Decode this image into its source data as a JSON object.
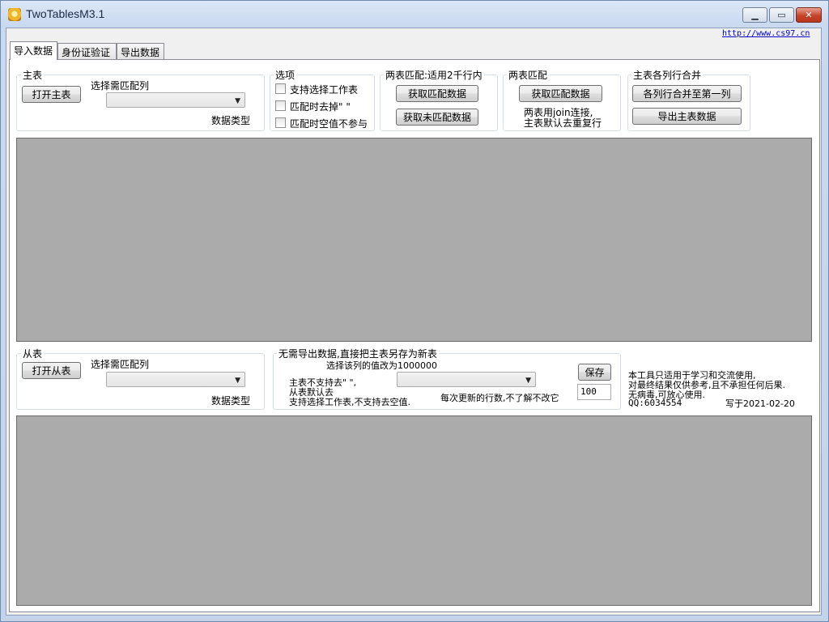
{
  "window": {
    "title": "TwoTablesM3.1",
    "minimize_glyph": "▁",
    "maximize_glyph": "▭",
    "close_glyph": "✕"
  },
  "header": {
    "link": "http://www.cs97.cn"
  },
  "tabs": [
    {
      "label": "导入数据",
      "active": true
    },
    {
      "label": "身份证验证",
      "active": false
    },
    {
      "label": "导出数据",
      "active": false
    }
  ],
  "main_table": {
    "group_label": "主表",
    "open_button": "打开主表",
    "select_label": "选择需匹配列",
    "select_value": "",
    "data_type_label": "数据类型"
  },
  "options": {
    "group_label": "选项",
    "items": [
      {
        "label": "支持选择工作表",
        "checked": false
      },
      {
        "label": "匹配时去掉\" \"",
        "checked": false
      },
      {
        "label": "匹配时空值不参与",
        "checked": false
      }
    ]
  },
  "match_limited": {
    "group_label": "两表匹配:适用2千行内",
    "get_match_button": "获取匹配数据",
    "get_unmatch_button": "获取未匹配数据"
  },
  "match_join": {
    "group_label": "两表匹配",
    "get_match_button": "获取匹配数据",
    "note_line1": "两表用join连接,",
    "note_line2": "主表默认去重复行"
  },
  "merge": {
    "group_label": "主表各列行合并",
    "merge_button": "各列行合并至第一列",
    "export_button": "导出主表数据"
  },
  "sub_table": {
    "group_label": "从表",
    "open_button": "打开从表",
    "select_label": "选择需匹配列",
    "select_value": "",
    "data_type_label": "数据类型"
  },
  "save_as": {
    "group_label": "无需导出数据,直接把主表另存为新表",
    "hint_top": "选择该列的值改为1000000",
    "note_line1": "主表不支持去\" \",",
    "note_line2": "从表默认去",
    "note_line3": "支持选择工作表,不支持去空值.",
    "select_value": "",
    "rows_hint": "每次更新的行数,不了解不改它",
    "save_button": "保存",
    "rows_value": "100"
  },
  "info": {
    "line1": "本工具只适用于学习和交流使用,",
    "line2": "对最终结果仅供参考,且不承担任何后果.",
    "line3": "无病毒,可放心使用.",
    "qq": "QQ:6034554",
    "written": "写于2021-02-20"
  },
  "colors": {
    "grid_bg": "#ababab",
    "titlebar": "#c9daf0",
    "close_button": "#c5452b"
  }
}
